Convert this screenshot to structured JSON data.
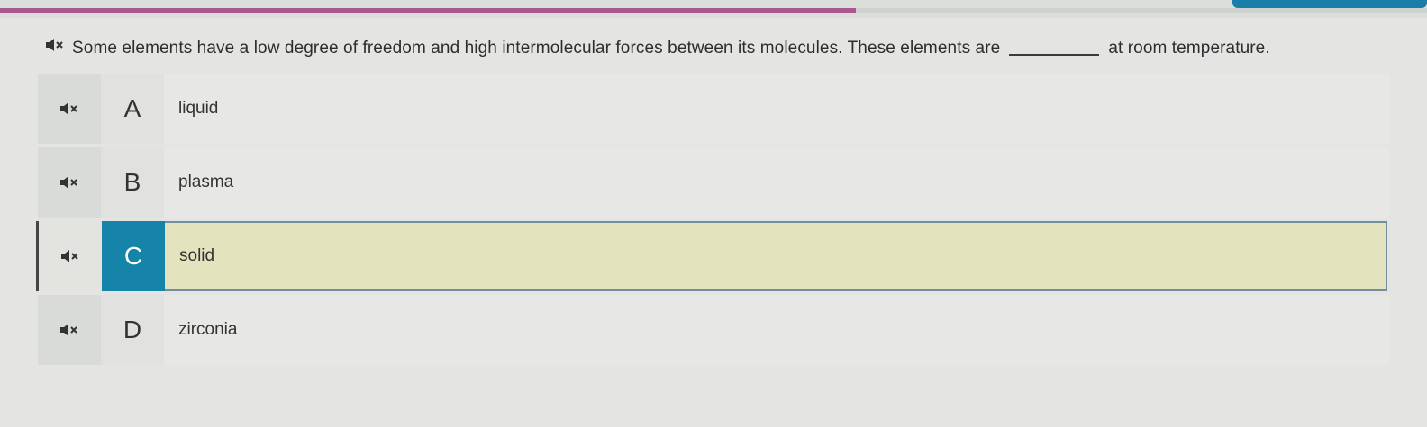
{
  "progress": {
    "fraction": 0.6
  },
  "colors": {
    "progress_fill": "#a9588f",
    "corner_button": "#1a7fa8",
    "selected_letter_bg": "#1684a8",
    "selected_row_bg": "#e3e3bd"
  },
  "question": {
    "speaker_icon": "speaker-mute-icon",
    "text_before": "Some elements have a low degree of freedom and high intermolecular forces between its molecules. These elements are",
    "text_after": "at room temperature."
  },
  "options": [
    {
      "letter": "A",
      "text": "liquid",
      "selected": false
    },
    {
      "letter": "B",
      "text": "plasma",
      "selected": false
    },
    {
      "letter": "C",
      "text": "solid",
      "selected": true
    },
    {
      "letter": "D",
      "text": "zirconia",
      "selected": false
    }
  ]
}
